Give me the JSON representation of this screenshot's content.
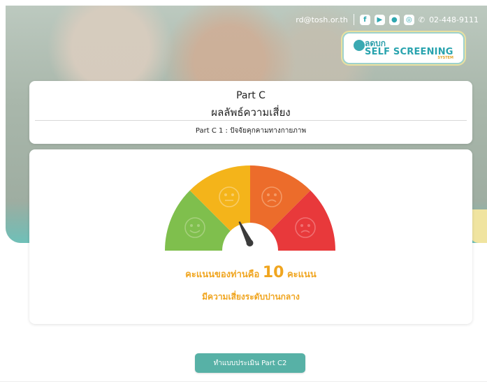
{
  "header": {
    "email": "rd@tosh.or.th",
    "phone": "02-448-9111",
    "socials": [
      {
        "icon": "facebook-icon",
        "glyph": "f"
      },
      {
        "icon": "youtube-icon",
        "glyph": "▶"
      },
      {
        "icon": "line-icon",
        "glyph": "●"
      },
      {
        "icon": "instagram-icon",
        "glyph": "◎"
      }
    ],
    "logo": {
      "small": "ลดบก",
      "main": "SELF SCREENING",
      "sub": "SYSTEM"
    }
  },
  "title": {
    "part": "Part C",
    "heading": "ผลลัพธ์ความเสี่ยง",
    "subheading": "Part C 1 : ปัจจัยคุกคามทางกายภาพ"
  },
  "result": {
    "score_prefix": "คะแนนของท่านคือ",
    "score": 10,
    "score_suffix": "คะแนน",
    "level": "มีความเสี่ยงระดับปานกลาง"
  },
  "gauge": {
    "segments": [
      {
        "name": "low",
        "color": "#7fbf4d",
        "face": "smile"
      },
      {
        "name": "medium",
        "color": "#f4b41a",
        "face": "neutral"
      },
      {
        "name": "high",
        "color": "#ec6c2b",
        "face": "sad"
      },
      {
        "name": "very-high",
        "color": "#e8393b",
        "face": "sad"
      }
    ],
    "needle_segment": "medium"
  },
  "actions": {
    "next_label": "ทำแบบประเมิน Part C2"
  }
}
